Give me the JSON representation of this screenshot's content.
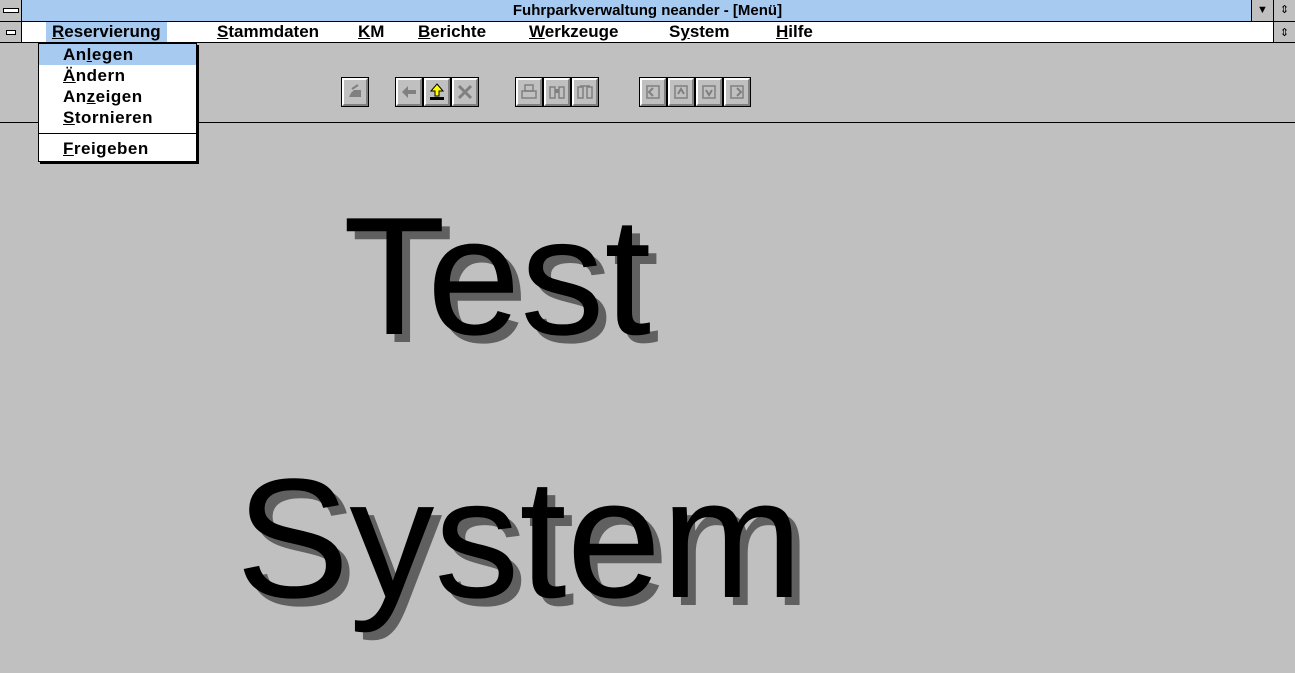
{
  "titlebar": {
    "title": "Fuhrparkverwaltung  neander - [Menü]"
  },
  "menubar": {
    "items": [
      {
        "pre": "",
        "acc": "R",
        "post": "eservierung"
      },
      {
        "pre": "",
        "acc": "S",
        "post": "tammdaten"
      },
      {
        "pre": "",
        "acc": "K",
        "post": "M"
      },
      {
        "pre": "",
        "acc": "B",
        "post": "erichte"
      },
      {
        "pre": "",
        "acc": "W",
        "post": "erkzeuge"
      },
      {
        "pre": "S",
        "acc": "y",
        "post": "stem"
      },
      {
        "pre": "",
        "acc": "H",
        "post": "ilfe"
      }
    ]
  },
  "dropdown": {
    "items": [
      {
        "pre": "An",
        "acc": "l",
        "post": "egen"
      },
      {
        "pre": "",
        "acc": "Ä",
        "post": "ndern"
      },
      {
        "pre": "An",
        "acc": "z",
        "post": "eigen"
      },
      {
        "pre": "",
        "acc": "S",
        "post": "tornieren"
      },
      {
        "pre": "",
        "acc": "F",
        "post": "reigeben"
      }
    ]
  },
  "toolbar": {
    "icons": [
      "exit-icon",
      "back-arrow-icon",
      "upload-icon",
      "cancel-x-icon",
      "print-icon",
      "binoculars-icon",
      "binoculars-disabled-icon",
      "first-record-icon",
      "previous-record-icon",
      "next-record-icon",
      "last-record-icon"
    ]
  },
  "content": {
    "line1": "Test",
    "line2": "System"
  },
  "colors": {
    "highlight": "#a6caf0",
    "face": "#c0c0c0"
  }
}
